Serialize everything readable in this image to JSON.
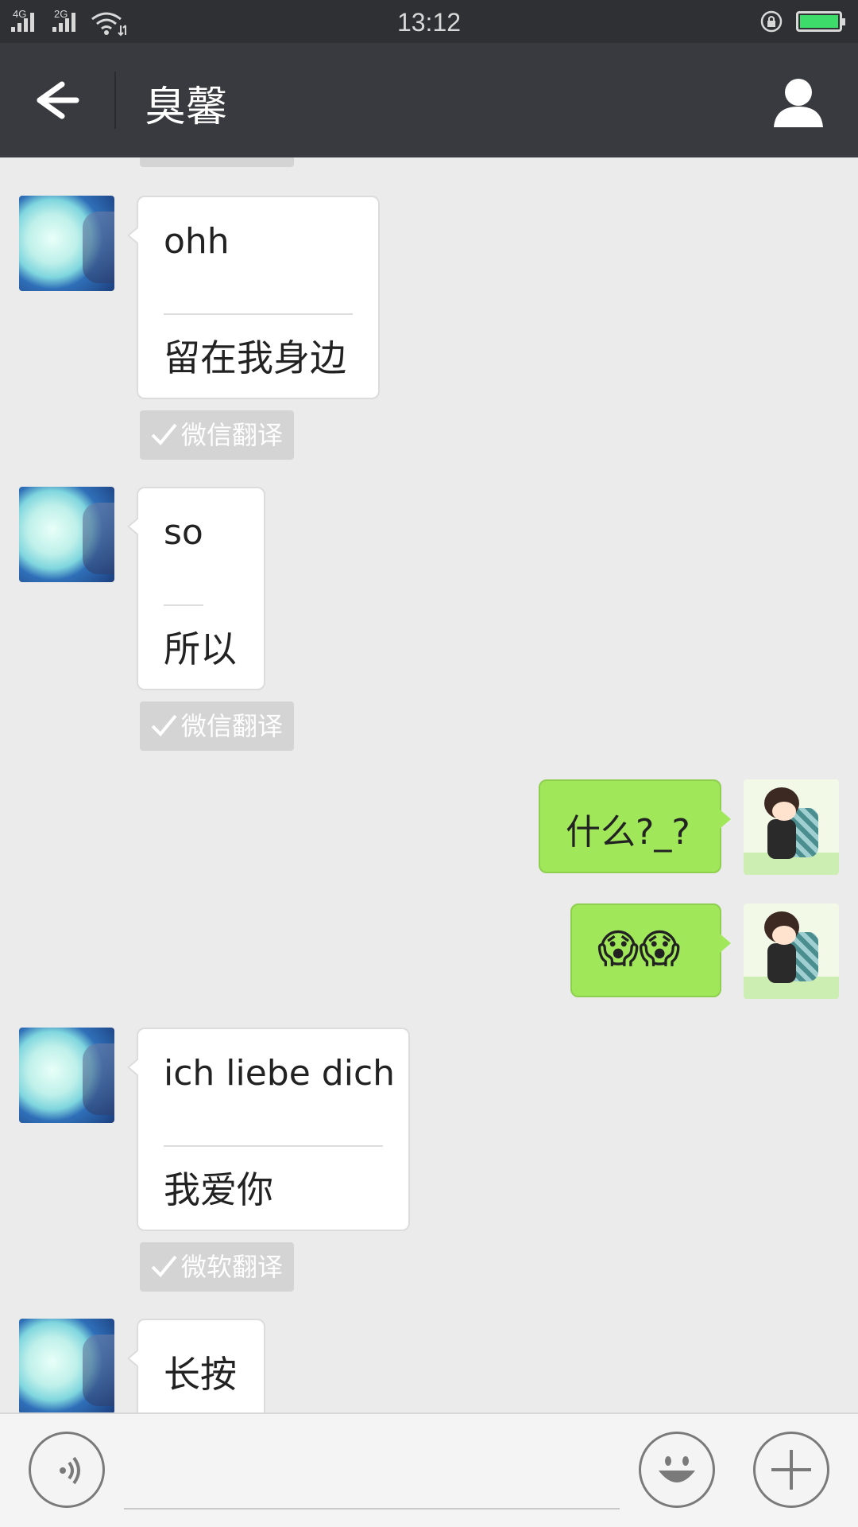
{
  "status_bar": {
    "network1": "4G",
    "network2": "2G",
    "time": "13:12"
  },
  "header": {
    "title": "臭馨",
    "back_icon": "back-arrow-icon",
    "profile_icon": "person-icon"
  },
  "messages": [
    {
      "side": "left",
      "original": "ohh",
      "translation": "留在我身边",
      "tag": "微信翻译"
    },
    {
      "side": "left",
      "original": "so",
      "translation": "所以",
      "tag": "微信翻译"
    },
    {
      "side": "right",
      "text": "什么?_?"
    },
    {
      "side": "right",
      "text": "😱😱"
    },
    {
      "side": "left",
      "original": "ich liebe dich",
      "translation": "我爱你",
      "tag": "微软翻译"
    },
    {
      "side": "left",
      "text": "长按"
    }
  ],
  "bottom_bar": {
    "voice_icon": "voice-icon",
    "emoji_icon": "smiley-icon",
    "plus_icon": "plus-icon"
  }
}
